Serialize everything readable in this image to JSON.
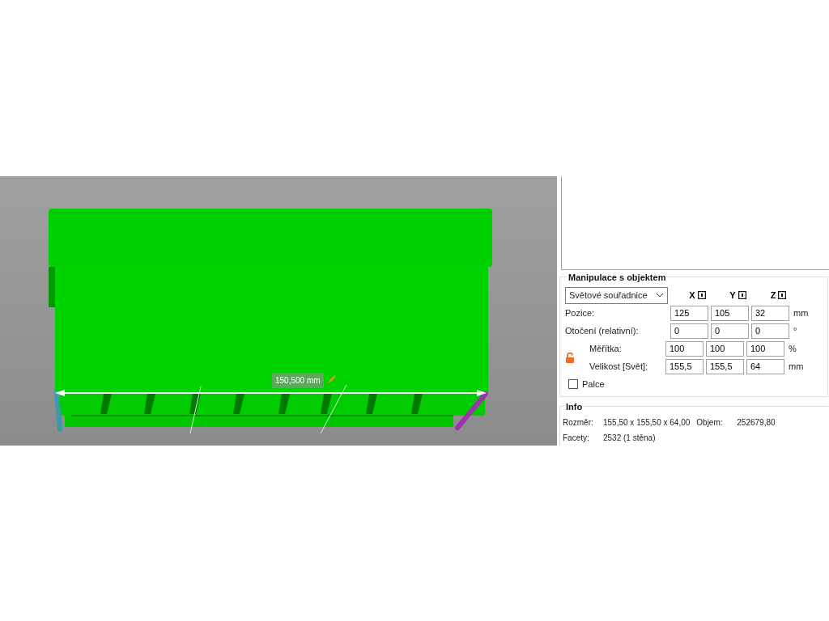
{
  "viewport": {
    "measure_label": "150,500 mm"
  },
  "object_manipulation": {
    "title": "Manipulace s objektem",
    "coordinate_system": "Světové souřadnice",
    "axes": [
      "X",
      "Y",
      "Z"
    ],
    "rows": [
      {
        "label": "Pozice:",
        "values": [
          "125",
          "105",
          "32"
        ],
        "unit": "mm"
      },
      {
        "label": "Otočení (relativní):",
        "values": [
          "0",
          "0",
          "0"
        ],
        "unit": "°"
      }
    ],
    "scale_rows": [
      {
        "label": "Měřítka:",
        "values": [
          "100",
          "100",
          "100"
        ],
        "unit": "%"
      },
      {
        "label": "Velikost [Svět]:",
        "values": [
          "155,5",
          "155,5",
          "64"
        ],
        "unit": "mm"
      }
    ],
    "inches": {
      "label": "Palce",
      "checked": false
    }
  },
  "info": {
    "title": "Info",
    "lines": [
      [
        {
          "label": "Rozměr:",
          "value": "155,50 x 155,50 x 64,00"
        },
        {
          "label": "Objem:",
          "value": "252679,80"
        }
      ],
      [
        {
          "label": "Facety:",
          "value": "2532 (1 stěna)"
        }
      ]
    ]
  }
}
